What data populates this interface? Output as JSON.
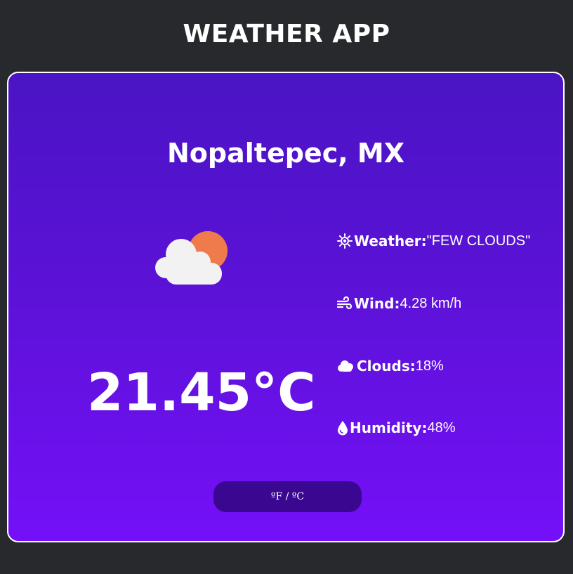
{
  "app": {
    "title": "WEATHER APP"
  },
  "location": {
    "name": "Nopaltepec, MX"
  },
  "current": {
    "icon": "partly-cloudy-icon",
    "temperature": "21.45°C"
  },
  "details": [
    {
      "icon": "sun-icon",
      "label": "Weather:",
      "value": "\"FEW CLOUDS\""
    },
    {
      "icon": "wind-icon",
      "label": "Wind:",
      "value": "4.28 km/h"
    },
    {
      "icon": "cloud-icon",
      "label": "Clouds:",
      "value": "18%"
    },
    {
      "icon": "droplet-icon",
      "label": "Humidity:",
      "value": "48%"
    }
  ],
  "toggle": {
    "label": "ºF / ºC"
  },
  "colors": {
    "background": "#27292c",
    "card_top": "#4a14c4",
    "card_bottom": "#7410f8",
    "button": "#3a0890",
    "sun": "#ef7a4c",
    "cloud": "#f2f2f2"
  }
}
